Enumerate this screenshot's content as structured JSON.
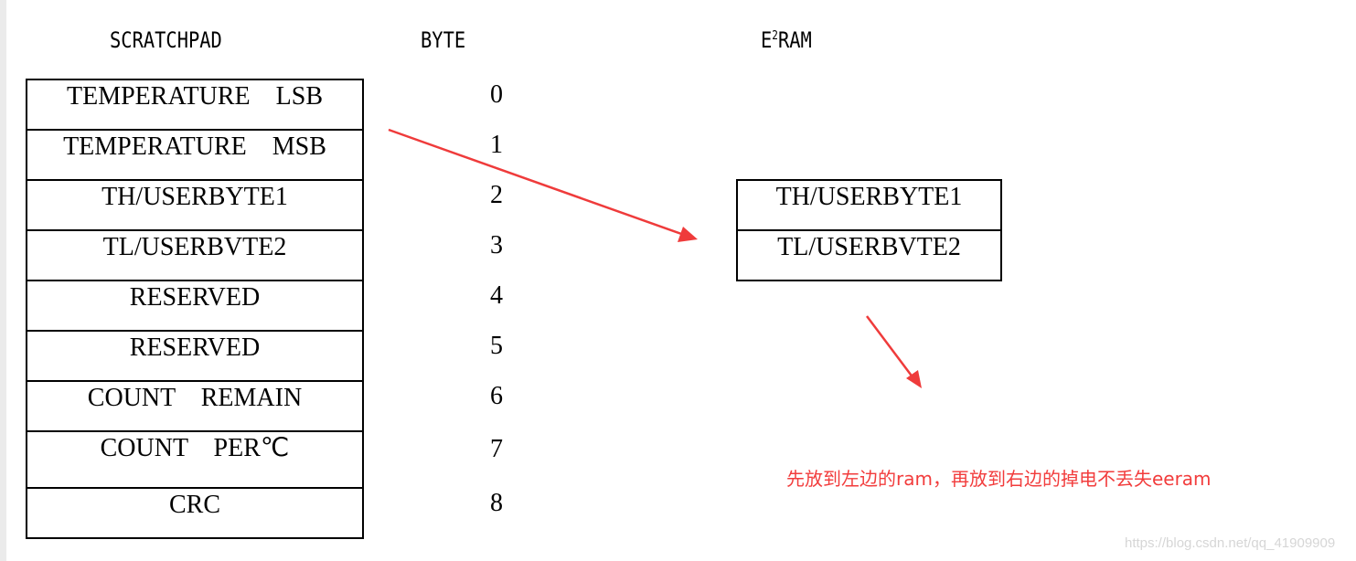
{
  "headers": {
    "scratchpad": "SCRATCHPAD",
    "byte": "BYTE",
    "eeram_prefix": "E",
    "eeram_sup": "2",
    "eeram_suffix": "RAM"
  },
  "scratchpad_rows": [
    {
      "label": "TEMPERATURE    LSB",
      "byte": "0"
    },
    {
      "label": "TEMPERATURE    MSB",
      "byte": "1"
    },
    {
      "label": "TH/USERBYTE1",
      "byte": "2"
    },
    {
      "label": "TL/USERBVTE2",
      "byte": "3"
    },
    {
      "label": "RESERVED",
      "byte": "4"
    },
    {
      "label": "RESERVED",
      "byte": "5"
    },
    {
      "label": "COUNT    REMAIN",
      "byte": "6"
    },
    {
      "label": "COUNT    PER℃",
      "byte": "7"
    },
    {
      "label": "CRC",
      "byte": "8"
    }
  ],
  "eeram_rows": [
    "TH/USERBYTE1",
    "TL/USERBVTE2"
  ],
  "annotation": "先放到左边的ram，再放到右边的掉电不丢失eeram",
  "watermark": "https://blog.csdn.net/qq_41909909",
  "colors": {
    "arrow": "#ef3b3b",
    "annotation": "#f23c3c"
  }
}
